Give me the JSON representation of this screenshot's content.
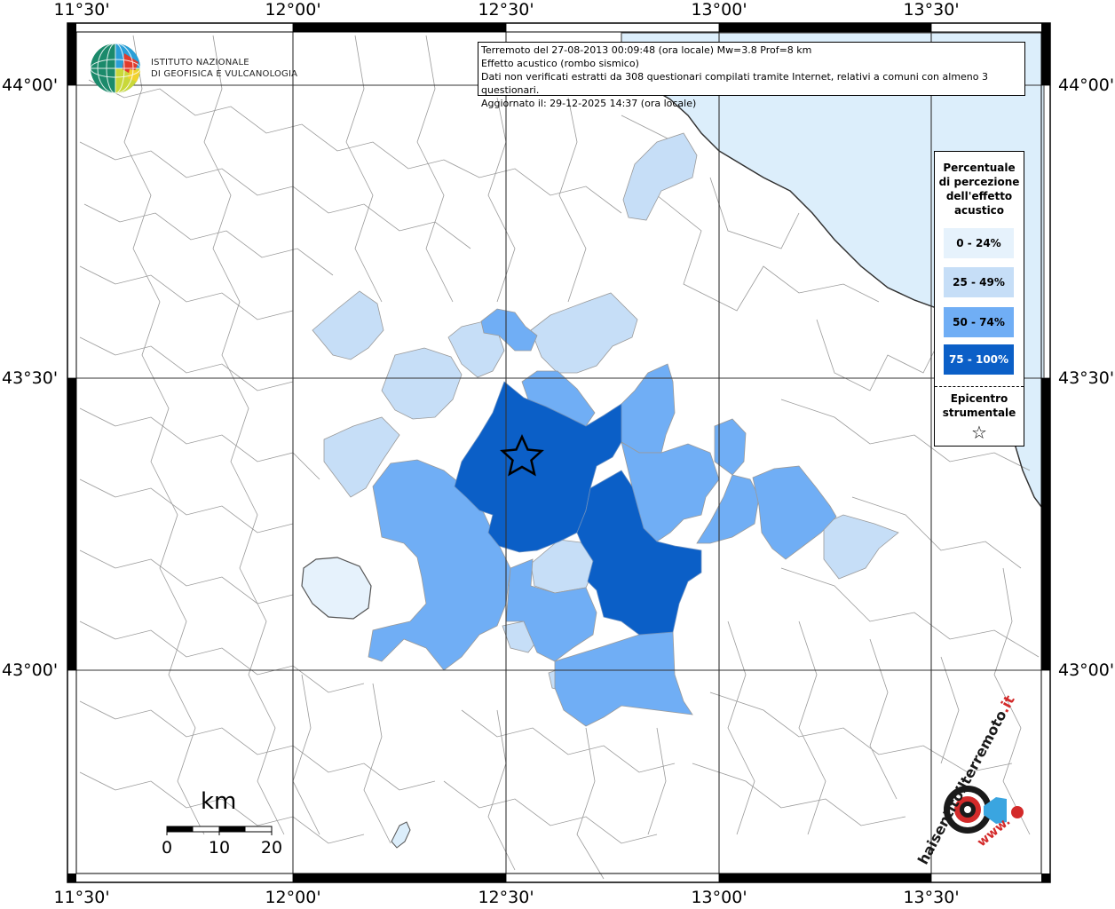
{
  "map": {
    "lon_ticks": [
      "11°30'",
      "12°00'",
      "12°30'",
      "13°00'",
      "13°30'"
    ],
    "lat_ticks": [
      "44°00'",
      "43°30'",
      "43°00'"
    ],
    "colors": {
      "sea": "#dceefb",
      "class_0_24": "#e6f2fc",
      "class_25_49": "#c6def7",
      "class_50_74": "#70aef5",
      "class_75_100": "#0b5fc7",
      "border": "#8c8c8c",
      "grid": "#333333"
    }
  },
  "info": {
    "line1": "Terremoto del 27-08-2013 00:09:48 (ora locale) Mw=3.8 Prof=8 km",
    "line2": "Effetto acustico (rombo sismico)",
    "line3": "Dati non verificati estratti da 308 questionari compilati tramite Internet, relativi a comuni con almeno 3 questionari.",
    "line4": "Aggiornato il: 29-12-2025 14:37 (ora locale)"
  },
  "logo": {
    "line1": "ISTITUTO NAZIONALE",
    "line2": "DI GEOFISICA E VULCANOLOGIA"
  },
  "legend": {
    "title_lines": [
      "Percentuale",
      "di percezione",
      "dell'effetto",
      "acustico"
    ],
    "items": [
      {
        "label": "0 - 24%",
        "color": "#e6f2fc",
        "text_color": "#000000"
      },
      {
        "label": "25 - 49%",
        "color": "#c6def7",
        "text_color": "#000000"
      },
      {
        "label": "50 - 74%",
        "color": "#70aef5",
        "text_color": "#000000"
      },
      {
        "label": "75 - 100%",
        "color": "#0b5fc7",
        "text_color": "#ffffff"
      }
    ],
    "epicenter_lines": [
      "Epicentro",
      "strumentale"
    ],
    "epicenter_symbol": "☆"
  },
  "scale": {
    "title": "km",
    "labels": [
      "0",
      "10",
      "20"
    ]
  },
  "watermark": {
    "text_main": "haisentitoilterremoto",
    "text_it": ".it",
    "text_www": "www."
  }
}
